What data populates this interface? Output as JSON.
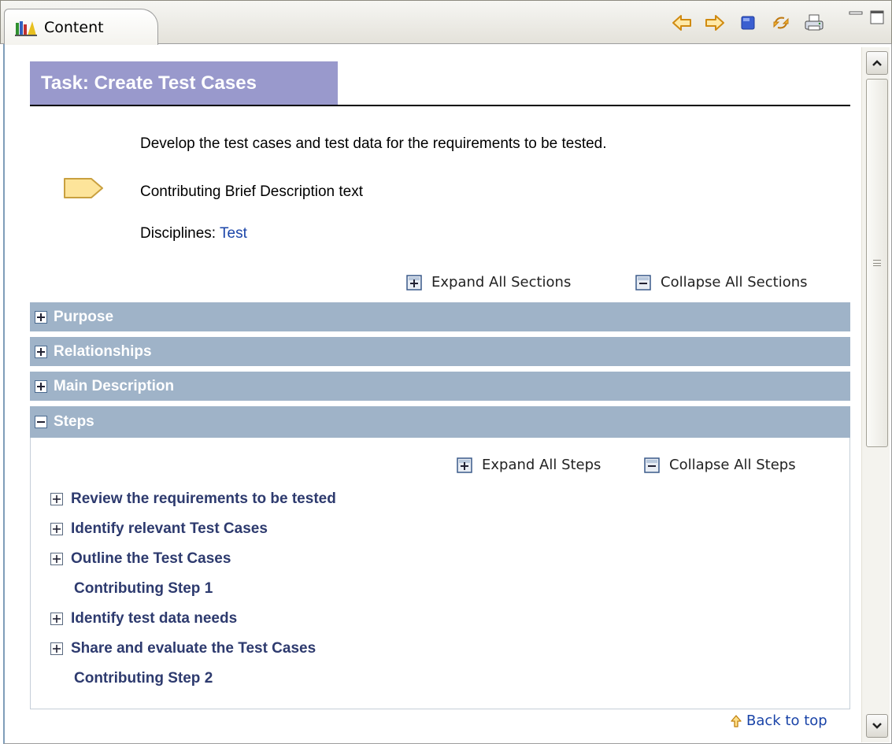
{
  "view": {
    "tab_label": "Content"
  },
  "toolbar": {
    "icons": [
      "back-arrow-icon",
      "forward-arrow-icon",
      "stop-icon",
      "sync-icon",
      "print-icon"
    ],
    "accent": "#f0a020"
  },
  "task": {
    "title": "Task: Create Test Cases",
    "brief_description": "Develop the test cases and test data for the requirements to be tested.",
    "contributing_brief": "Contributing Brief Description text",
    "disciplines_label": "Disciplines: ",
    "disciplines_link": "Test"
  },
  "section_controls": {
    "expand": "Expand All Sections",
    "collapse": "Collapse All Sections"
  },
  "sections": {
    "purpose": "Purpose",
    "relationships": "Relationships",
    "main_description": "Main Description",
    "steps": "Steps"
  },
  "step_controls": {
    "expand": "Expand All Steps",
    "collapse": "Collapse All Steps"
  },
  "steps": {
    "s1": "Review the requirements to be tested",
    "s2": "Identify relevant Test Cases",
    "s3": "Outline the Test Cases",
    "c1": "Contributing Step 1",
    "s4": "Identify test data needs",
    "s5": "Share and evaluate the Test Cases",
    "c2": "Contributing Step 2"
  },
  "footer": {
    "back_to_top": "Back to top"
  },
  "colors": {
    "title_bg": "#9999cc",
    "section_bg": "#9fb3c8",
    "link": "#1a44a8",
    "step_text": "#2d3a6e"
  }
}
